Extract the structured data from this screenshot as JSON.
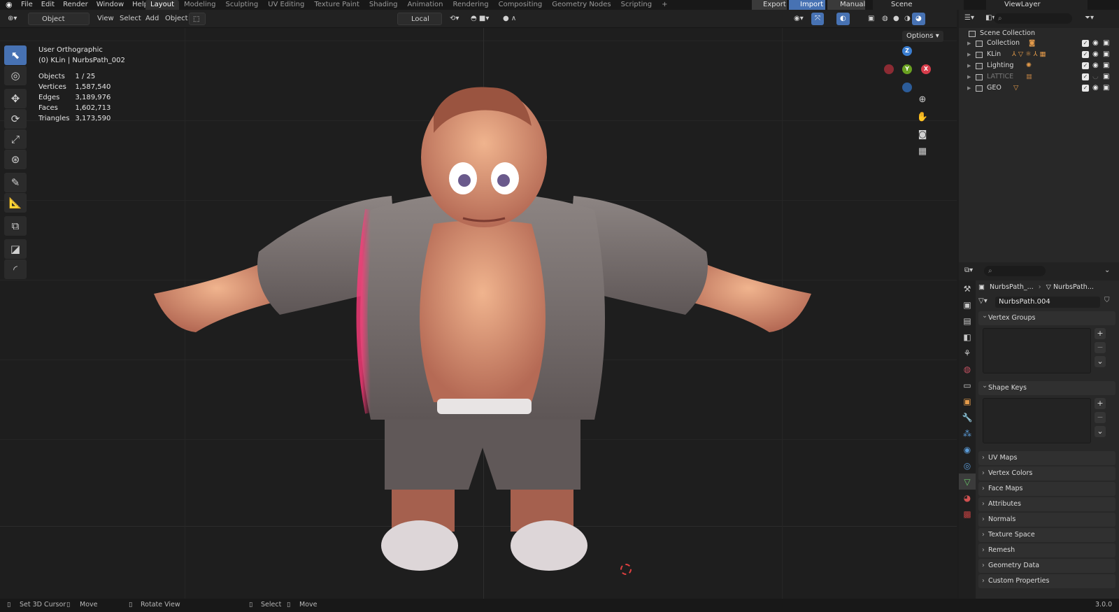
{
  "menus": [
    "File",
    "Edit",
    "Render",
    "Window",
    "Help"
  ],
  "workspaces": [
    "Layout",
    "Modeling",
    "Sculpting",
    "UV Editing",
    "Texture Paint",
    "Shading",
    "Animation",
    "Rendering",
    "Compositing",
    "Geometry Nodes",
    "Scripting"
  ],
  "topright": {
    "export": "Export",
    "import": "Import",
    "manual": "Manual",
    "scene": "Scene",
    "view_layer": "ViewLayer"
  },
  "header": {
    "mode": "Object Mode",
    "view": "View",
    "select": "Select",
    "add": "Add",
    "object": "Object",
    "pivot": "Local",
    "options": "Options"
  },
  "viewport": {
    "view_name": "User Orthographic",
    "active": "(0) KLin | NurbsPath_002"
  },
  "stats": [
    {
      "label": "Objects",
      "value": "1 / 25"
    },
    {
      "label": "Vertices",
      "value": "1,587,540"
    },
    {
      "label": "Edges",
      "value": "3,189,976"
    },
    {
      "label": "Faces",
      "value": "1,602,713"
    },
    {
      "label": "Triangles",
      "value": "3,173,590"
    }
  ],
  "gizmo": {
    "z": "Z",
    "y": "Y",
    "x": "X"
  },
  "outliner": {
    "root": "Scene Collection",
    "items": [
      {
        "name": "Collection"
      },
      {
        "name": "KLin"
      },
      {
        "name": "Lighting"
      },
      {
        "name": "LATTICE"
      },
      {
        "name": "GEO"
      }
    ]
  },
  "properties": {
    "crumb1": "NurbsPath_...",
    "crumb2": "NurbsPath...",
    "data_name": "NurbsPath.004",
    "panels_open": [
      "Vertex Groups",
      "Shape Keys"
    ],
    "panels_closed": [
      "UV Maps",
      "Vertex Colors",
      "Face Maps",
      "Attributes",
      "Normals",
      "Texture Space",
      "Remesh",
      "Geometry Data",
      "Custom Properties"
    ]
  },
  "status": {
    "cursor": "Set 3D Cursor",
    "move1": "Move",
    "rotate": "Rotate View",
    "select": "Select",
    "move2": "Move",
    "version": "3.0.0"
  },
  "colors": {
    "accent": "#4772b3",
    "x_axis": "#d63c4a",
    "y_axis": "#6aa121",
    "z_axis": "#3b7ed1"
  }
}
